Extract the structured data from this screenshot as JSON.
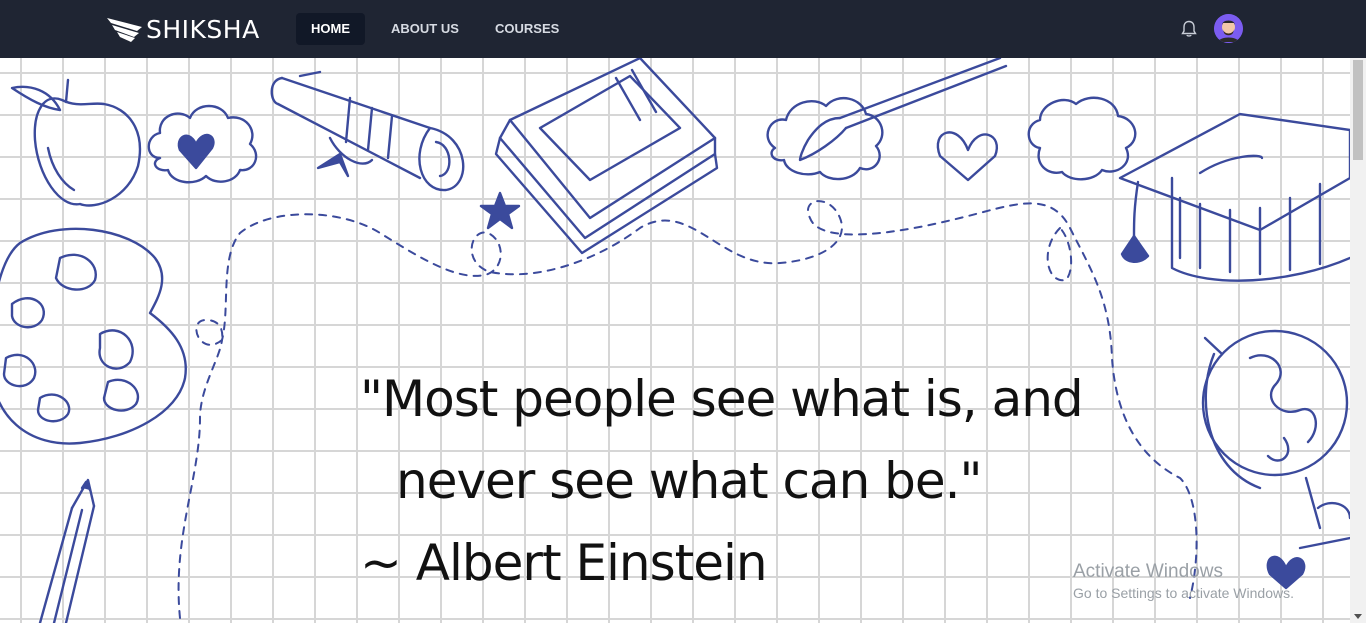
{
  "brand": {
    "name": "SHIKSHA"
  },
  "nav": {
    "items": [
      {
        "label": "HOME",
        "active": true
      },
      {
        "label": "ABOUT US",
        "active": false
      },
      {
        "label": "COURSES",
        "active": false
      }
    ]
  },
  "header_icons": {
    "notifications": "bell-icon",
    "profile": "avatar"
  },
  "hero": {
    "quote_line1": "\"Most people see what is, and",
    "quote_line2": "never see what can be.\"",
    "author": "~ Albert Einstein"
  },
  "watermark": {
    "title": "Activate Windows",
    "subtitle": "Go to Settings to activate Windows."
  },
  "colors": {
    "navbar": "#1f2533",
    "doodle": "#3b4a9c",
    "active_tab": "#111827"
  }
}
